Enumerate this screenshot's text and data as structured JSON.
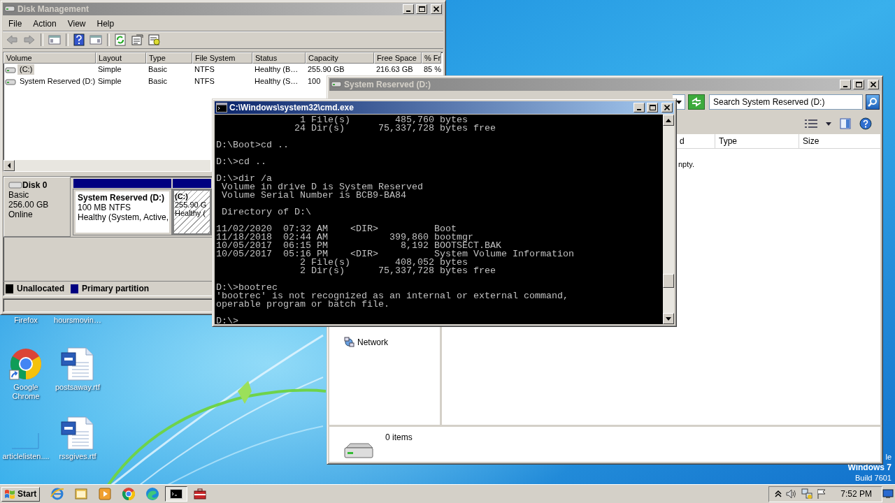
{
  "desktop": {
    "icons": [
      {
        "label": "Firefox",
        "kind": "hidden"
      },
      {
        "label": "hoursmovin…",
        "kind": "hidden"
      },
      {
        "label": "Google Chrome",
        "kind": "chrome"
      },
      {
        "label": "postsaway.rtf",
        "kind": "document"
      },
      {
        "label": "articlelisten....",
        "kind": "blank"
      },
      {
        "label": "rssgives.rtf",
        "kind": "document"
      }
    ],
    "notice": [
      "le",
      "Windows 7",
      "Build 7601"
    ]
  },
  "disk_management": {
    "window": {
      "title": "Disk Management",
      "active": false
    },
    "menu": [
      "File",
      "Action",
      "View",
      "Help"
    ],
    "volumes": {
      "columns": [
        "Volume",
        "Layout",
        "Type",
        "File System",
        "Status",
        "Capacity",
        "Free Space",
        "% Fr"
      ],
      "rows": [
        {
          "cells": [
            "(C:)",
            "Simple",
            "Basic",
            "NTFS",
            "Healthy (B…",
            "255.90 GB",
            "216.63 GB",
            "85 %"
          ],
          "selected": true
        },
        {
          "cells": [
            "System Reserved (D:)",
            "Simple",
            "Basic",
            "NTFS",
            "Healthy (S…",
            "100"
          ],
          "selected": false
        }
      ]
    },
    "disk": {
      "name": "Disk 0",
      "type": "Basic",
      "size": "256.00 GB",
      "status": "Online",
      "partitions": [
        {
          "name": "System Reserved  (D:)",
          "size": "100 MB NTFS",
          "status": "Healthy (System, Active,",
          "selected": false
        },
        {
          "name": "(C:)",
          "size": "255.90 G",
          "status": "Healthy (",
          "selected": true
        }
      ]
    },
    "legend": [
      {
        "label": "Unallocated",
        "color": "#000000"
      },
      {
        "label": "Primary partition",
        "color": "#000080"
      }
    ]
  },
  "explorer": {
    "window": {
      "title": "System Reserved (D:)",
      "active": false
    },
    "search": {
      "placeholder": "Search System Reserved (D:)"
    },
    "columns": [
      "d",
      "Type",
      "Size"
    ],
    "message": "npty.",
    "nav": [
      {
        "label": "Network",
        "kind": "network"
      }
    ],
    "details": "0 items"
  },
  "cmd": {
    "window": {
      "title": "C:\\Windows\\system32\\cmd.exe",
      "active": true
    },
    "blocks": [
      [
        "               1 File(s)        485,760 bytes",
        "              24 Dir(s)      75,337,728 bytes free"
      ],
      [
        "D:\\Boot>cd .."
      ],
      [
        "D:\\>cd .."
      ],
      [
        "D:\\>dir /a",
        " Volume in drive D is System Reserved",
        " Volume Serial Number is BCB9-BA84"
      ],
      [
        " Directory of D:\\"
      ],
      [
        "11/02/2020  07:32 AM    <DIR>          Boot",
        "11/18/2018  02:44 AM           399,860 bootmgr",
        "10/05/2017  06:15 PM             8,192 BOOTSECT.BAK",
        "10/05/2017  05:16 PM    <DIR>          System Volume Information",
        "               2 File(s)        408,052 bytes",
        "               2 Dir(s)      75,337,728 bytes free"
      ],
      [
        "D:\\>bootrec",
        "'bootrec' is not recognized as an internal or external command,",
        "operable program or batch file."
      ],
      [
        "D:\\>"
      ]
    ]
  },
  "taskbar": {
    "start": "Start",
    "apps": [
      {
        "kind": "ie",
        "selected": false
      },
      {
        "kind": "folder",
        "selected": false
      },
      {
        "kind": "media",
        "selected": false
      },
      {
        "kind": "chrome",
        "selected": false
      },
      {
        "kind": "edge",
        "selected": false
      },
      {
        "kind": "cmd",
        "selected": true
      },
      {
        "kind": "toolbox",
        "selected": false
      }
    ],
    "clock": "7:52 PM"
  }
}
